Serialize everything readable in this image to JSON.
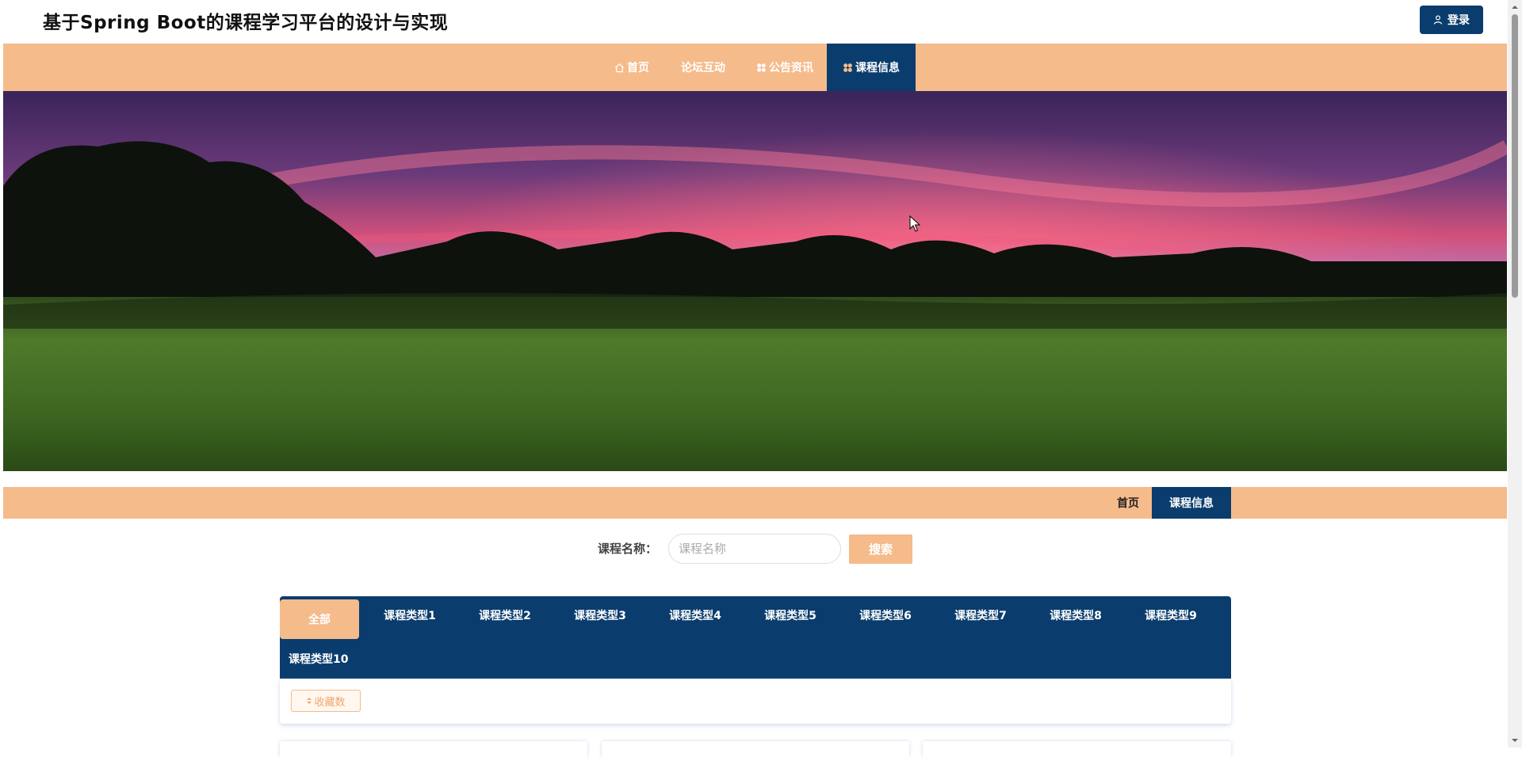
{
  "header": {
    "site_title": "基于Spring Boot的课程学习平台的设计与实现",
    "login_label": "登录"
  },
  "nav": {
    "items": [
      {
        "label": "首页",
        "icon": "home-icon"
      },
      {
        "label": "论坛互动",
        "icon": ""
      },
      {
        "label": "公告资讯",
        "icon": "grid-icon"
      },
      {
        "label": "课程信息",
        "icon": "flower-icon",
        "active": true
      }
    ]
  },
  "breadcrumb": {
    "home": "首页",
    "current": "课程信息"
  },
  "search": {
    "label": "课程名称：",
    "placeholder": "课程名称",
    "value": "",
    "button": "搜索"
  },
  "categories": {
    "items": [
      "全部",
      "课程类型1",
      "课程类型2",
      "课程类型3",
      "课程类型4",
      "课程类型5",
      "课程类型6",
      "课程类型7",
      "课程类型8",
      "课程类型9",
      "课程类型10"
    ],
    "selected": "全部"
  },
  "sort": {
    "label": "收藏数"
  },
  "colors": {
    "accent": "#f5bb8b",
    "primary": "#0a3d6e"
  }
}
